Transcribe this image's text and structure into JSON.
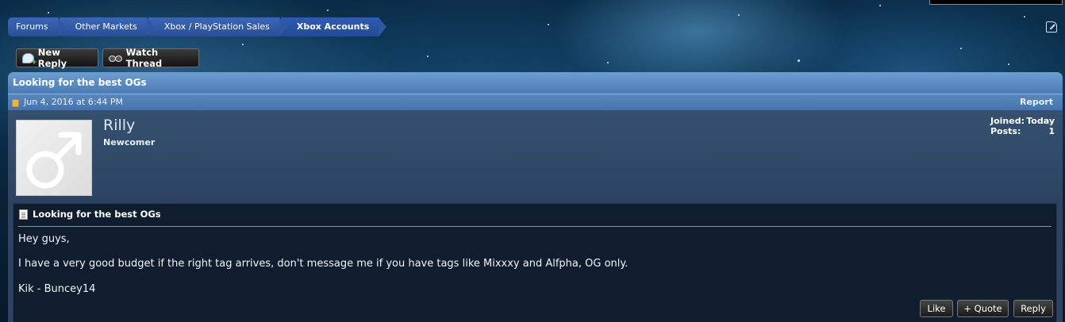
{
  "breadcrumb": [
    {
      "label": "Forums"
    },
    {
      "label": "Other Markets"
    },
    {
      "label": "Xbox / PlayStation Sales"
    },
    {
      "label": "Xbox Accounts"
    }
  ],
  "actions": {
    "new_reply": "New Reply",
    "watch_thread": "Watch Thread"
  },
  "thread": {
    "title": "Looking for the best OGs"
  },
  "post": {
    "date": "Jun 4, 2016 at 6:44 PM",
    "report": "Report",
    "author": {
      "name": "Rilly",
      "title": "Newcomer",
      "joined_label": "Joined:",
      "joined_value": "Today",
      "posts_label": "Posts:",
      "posts_value": "1"
    },
    "message_title": "Looking for the best OGs",
    "body": [
      "Hey guys,",
      "I have a very good budget if the right tag arrives, don't message me if you have tags like Mixxxy and Alfpha, OG only.",
      "Kik - Buncey14"
    ],
    "buttons": {
      "like": "Like",
      "quote": "+ Quote",
      "reply": "Reply"
    }
  },
  "icons": {
    "new_reply": "speech-bubble-icon",
    "watch_thread": "glasses-icon",
    "post_status": "new-post-icon",
    "message": "document-icon",
    "avatar": "male-symbol-icon",
    "popout": "popout-icon"
  }
}
